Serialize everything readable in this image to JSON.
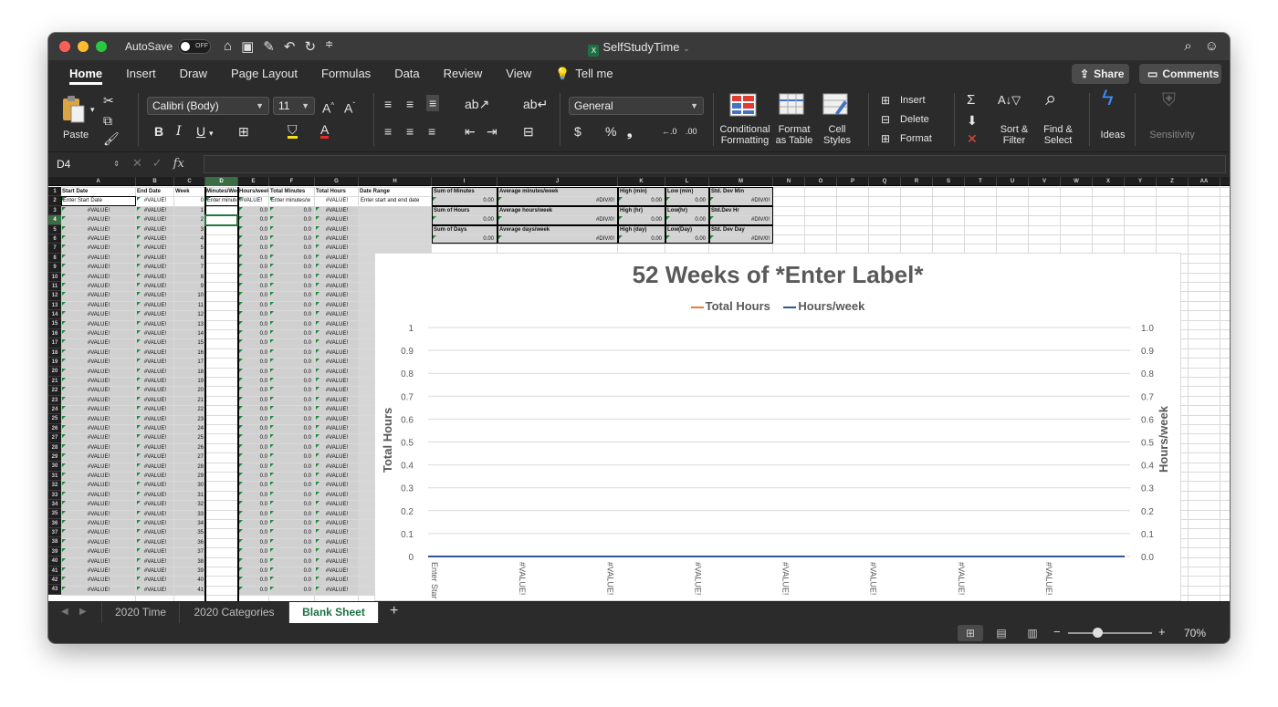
{
  "titlebar": {
    "autosave_label": "AutoSave",
    "autosave_state": "OFF",
    "document_title": "SelfStudyTime"
  },
  "tabs": [
    "Home",
    "Insert",
    "Draw",
    "Page Layout",
    "Formulas",
    "Data",
    "Review",
    "View",
    "Tell me"
  ],
  "share_label": "Share",
  "comments_label": "Comments",
  "ribbon": {
    "paste_label": "Paste",
    "font_name": "Calibri (Body)",
    "font_size": "11",
    "number_format": "General",
    "conditional_formatting": [
      "Conditional",
      "Formatting"
    ],
    "format_as_table": [
      "Format",
      "as Table"
    ],
    "cell_styles": [
      "Cell",
      "Styles"
    ],
    "insert_label": "Insert",
    "delete_label": "Delete",
    "format_label": "Format",
    "sort_filter": [
      "Sort &",
      "Filter"
    ],
    "find_select": [
      "Find &",
      "Select"
    ],
    "ideas_label": "Ideas",
    "sensitivity_label": "Sensitivity"
  },
  "formula_bar": {
    "name_box": "D4",
    "fx_label": "fx",
    "formula": ""
  },
  "columns": [
    "A",
    "B",
    "C",
    "D",
    "E",
    "F",
    "G",
    "H",
    "I",
    "J",
    "K",
    "L",
    "M",
    "N",
    "O",
    "P",
    "Q",
    "R",
    "S",
    "T",
    "U",
    "V",
    "W",
    "X",
    "Y",
    "Z",
    "AA"
  ],
  "selected_column": "D",
  "selected_row": 4,
  "headers": {
    "A": "Start Date",
    "B": "End Date",
    "C": "Week",
    "D": "Minutes/Week",
    "E": "Hours/week",
    "F": "Total Minutes",
    "G": "Total Hours",
    "H": "Date Range"
  },
  "row2": {
    "A": "Enter Start Date",
    "B": "#VALUE!",
    "C": "0",
    "D": "Enter minutes",
    "E": "#VALUE!",
    "F": "Enter minutes/w",
    "G": "#VALUE!",
    "H": "Enter start and end date"
  },
  "data_rows_value": "#VALUE!",
  "data_rows_decimal": "0.0",
  "summary": {
    "sum_minutes_label": "Sum of Minutes",
    "sum_minutes_value": "0.00",
    "avg_min_week_label": "Average minutes/week",
    "avg_min_week_value": "#DIV/0!",
    "high_min_label": "High (min)",
    "high_min_value": "0.00",
    "low_min_label": "Low (min)",
    "low_min_value": "0.00",
    "std_min_label": "Std. Dev Min",
    "std_min_value": "#DIV/0!",
    "sum_hours_label": "Sum of Hours",
    "sum_hours_value": "0.00",
    "avg_hr_week_label": "Average hours/week",
    "avg_hr_week_value": "#DIV/0!",
    "high_hr_label": "High (hr)",
    "high_hr_value": "0.00",
    "low_hr_label": "Low(hr)",
    "low_hr_value": "0.00",
    "std_hr_label": "Std.Dev Hr",
    "std_hr_value": "#DIV/0!",
    "sum_days_label": "Sum of Days",
    "sum_days_value": "0.00",
    "avg_days_week_label": "Average days/week",
    "avg_days_week_value": "#DIV/0!",
    "high_day_label": "High (day)",
    "high_day_value": "0.00",
    "low_day_label": "Low(Day)",
    "low_day_value": "0.00",
    "std_day_label": "Std. Dev Day",
    "std_day_value": "#DIV/0!"
  },
  "chart_data": {
    "type": "line",
    "title": "52 Weeks of *Enter Label*",
    "series": [
      {
        "name": "Total Hours",
        "color": "#ed7d31",
        "values": [
          0,
          0,
          0,
          0,
          0,
          0,
          0,
          0
        ]
      },
      {
        "name": "Hours/week",
        "color": "#2f5597",
        "values": [
          0,
          0,
          0,
          0,
          0,
          0,
          0,
          0
        ]
      }
    ],
    "categories": [
      "Enter Star",
      "#VALUE!",
      "#VALUE!",
      "#VALUE!",
      "#VALUE!",
      "#VALUE!",
      "#VALUE!",
      "#VALUE!"
    ],
    "ylabel": "Total Hours",
    "y2label": "Hours/week",
    "ylim": [
      0,
      1
    ],
    "yticks": [
      "0",
      "0.1",
      "0.2",
      "0.3",
      "0.4",
      "0.5",
      "0.6",
      "0.7",
      "0.8",
      "0.9",
      "1"
    ],
    "y2ticks": [
      "0.0",
      "0.1",
      "0.2",
      "0.3",
      "0.4",
      "0.5",
      "0.6",
      "0.7",
      "0.8",
      "0.9",
      "1.0"
    ],
    "grid": true,
    "legend": "top"
  },
  "sheet_tabs": [
    "2020 Time",
    "2020 Categories",
    "Blank Sheet"
  ],
  "active_sheet": "Blank Sheet",
  "zoom": "70%"
}
